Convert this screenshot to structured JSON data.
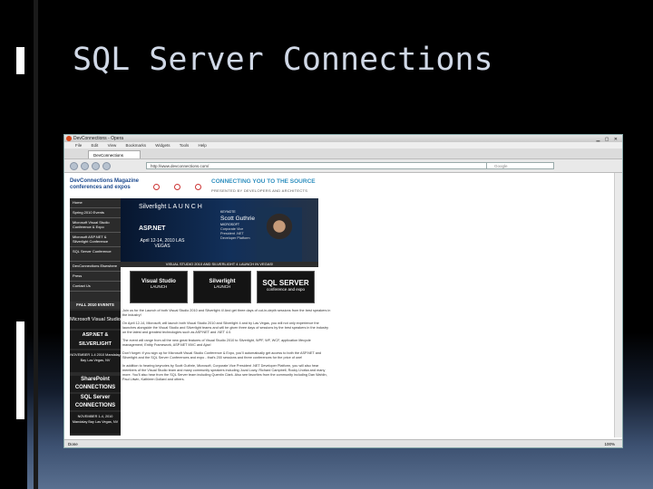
{
  "slide": {
    "title": "SQL Server Connections"
  },
  "browser": {
    "window_title": "DevConnections - Opera",
    "menu": [
      "File",
      "Edit",
      "View",
      "Bookmarks",
      "Widgets",
      "Tools",
      "Help"
    ],
    "tab_label": "DevConnections",
    "url": "http://www.devconnections.com/",
    "search_placeholder": "Google",
    "status_left": "Done",
    "zoom": "100%"
  },
  "site": {
    "logo": "DevConnections Magazine conferences and expos",
    "tagline": "CONNECTING YOU TO THE SOURCE",
    "subtag": "PRESENTED BY DEVELOPERS AND ARCHITECTS",
    "nav": [
      "Home",
      "Spring 2010 Events",
      "Microsoft Visual Studio Conference & Expo",
      "Microsoft ASP.NET & Silverlight Conference",
      "SQL Server Conference",
      "DevConnections Elsewhere",
      "Press",
      "Contact Us"
    ],
    "fall_events": "FALL 2010 EVENTS",
    "vs_panel": "Microsoft Visual Studio",
    "aspnet_panel": "ASP.NET & SILVERLIGHT",
    "aspnet_date": "NOVEMBER 1-4 2010 Mandalay Bay Las Vegas, NV",
    "sharepoint": "SharePoint CONNECTIONS",
    "sqlserver": "SQL Server CONNECTIONS",
    "sql_date": "NOVEMBER 1-4, 2010 Mandalay Bay Las Vegas, NV"
  },
  "hero": {
    "product": "Silverlight L A U N C H",
    "product2": "ASP.NET",
    "date": "April 12-14, 2010 LAS VEGAS",
    "speaker_label": "KEYNOTE",
    "speaker": "Scott Guthrie",
    "speaker_company": "MICROSOFT",
    "speaker_title": "Corporate Vice President .NET Developer Platform",
    "banner": "VISUAL STUDIO 2010 AND SILVERLIGHT 4 LAUNCH IN VEGAS!"
  },
  "logos": [
    {
      "name": "Visual Studio",
      "sub": "LAUNCH"
    },
    {
      "name": "Silverlight",
      "sub": "LAUNCH"
    },
    {
      "name": "SQL SERVER",
      "sub": "conference and expo"
    }
  ],
  "article": [
    "Join us for the Launch of both Visual Studio 2010 and Silverlight 4! And get three days of cut-in-depth sessions from the best speakers in the industry!",
    "On April 12-14, Microsoft, will launch both Visual Studio 2010 and Silverlight 4 and by Las Vegas, you will not only experience the launches alongside the Visual Studio and Silverlight teams and will be given three days of sessions by the best speakers in the industry on the latest and greatest technologies such as ASP.NET and .NET 4.0.",
    "The event will range from all the new great features of Visual Studio 2010 to Silverlight, WPF, WF, WCF, application lifecycle management, Entity Framework, ASP.NET MVC and Ajax!",
    "Don't forget: if you sign up for Microsoft Visual Studio Conference & Expo, you'll automatically get access to both the ASP.NET and Silverlight and the SQL Server Conferences and expo - that's 200 sessions and three conferences for the price of one!",
    "In addition to hearing keynotes by Scott Guthrie, Microsoft, Corporate Vice President .NET Developer Platform, you will also hear members of the Visual Studio team and many community speakers including Juval Lowy, Richard Campbell, Rocky Lhotka and many more. You'll also hear from the SQL Server team including Quentin Clark. Also see favorites from the community including Dan Wahlin, Paul Litwin, Kathleen Dollard and others."
  ]
}
